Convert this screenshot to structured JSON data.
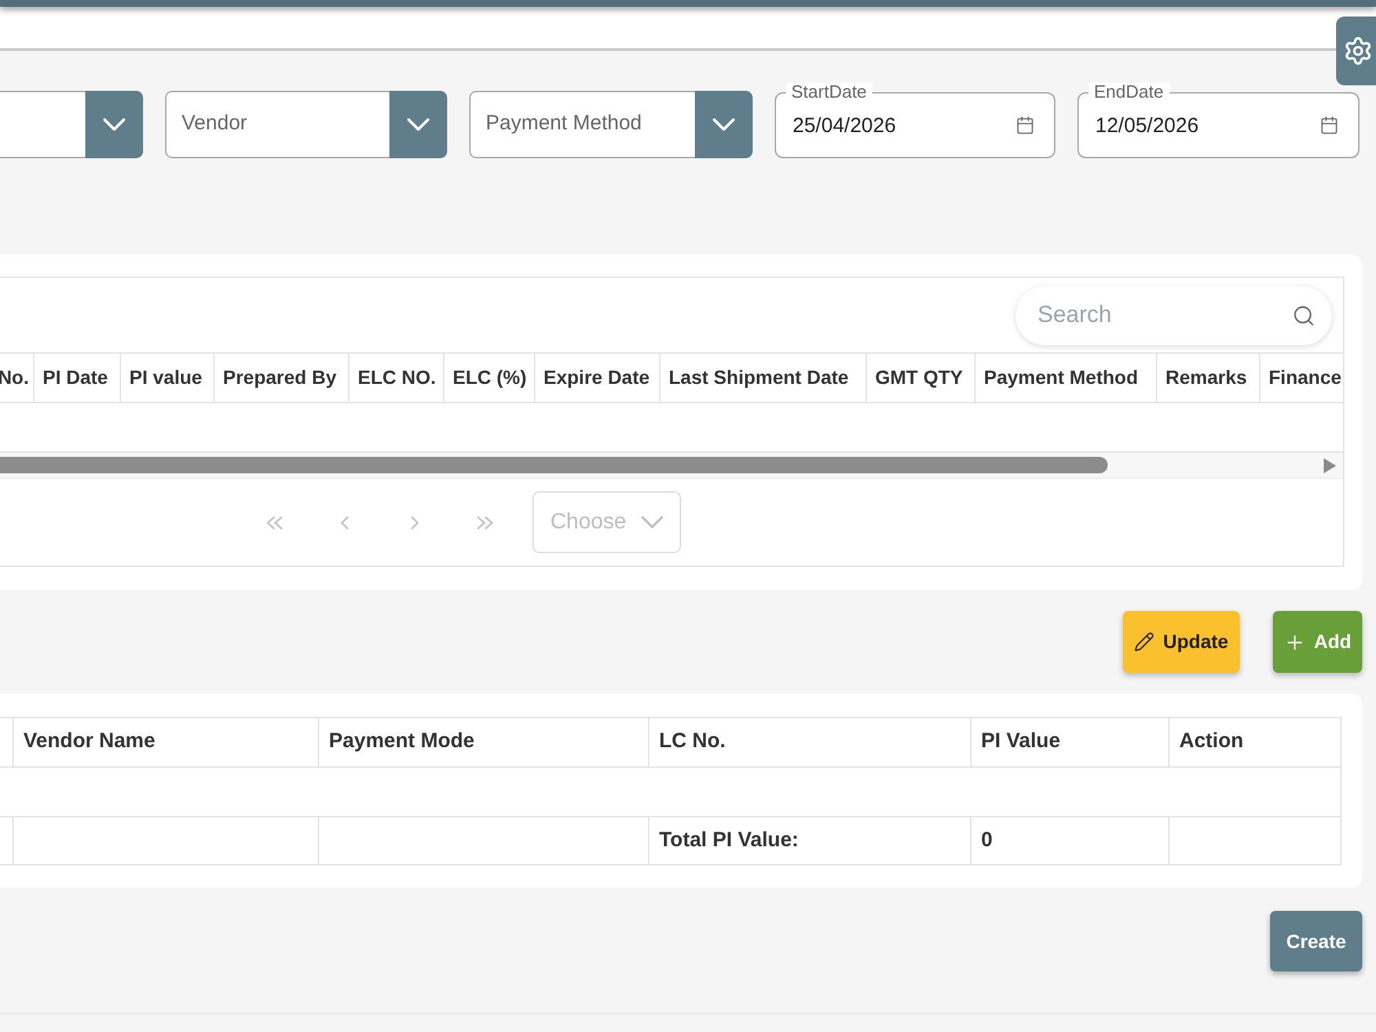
{
  "filters": [
    {
      "kind": "select"
    },
    {
      "kind": "select",
      "placeholder": "Vendor"
    },
    {
      "kind": "select",
      "placeholder": "Payment Method"
    },
    {
      "kind": "date",
      "label": "StartDate",
      "value": "25/04/2026"
    },
    {
      "kind": "date",
      "label": "EndDate",
      "value": "12/05/2026"
    }
  ],
  "pi_table": {
    "search": {
      "placeholder": "Search"
    },
    "columns": [
      "No.",
      "PI Date",
      "PI value",
      "Prepared By",
      "ELC NO.",
      "ELC (%)",
      "Expire Date",
      "Last Shipment Date",
      "GMT QTY",
      "Payment Method",
      "Remarks",
      "Finance"
    ],
    "pagination": {
      "buttons": [
        {
          "kind": "first",
          "disabled": true
        },
        {
          "kind": "previous",
          "disabled": true
        },
        {
          "kind": "next",
          "disabled": true
        },
        {
          "kind": "last",
          "disabled": true
        }
      ],
      "page_size": {
        "placeholder": "Choose"
      }
    }
  },
  "actions": [
    {
      "kind": "update",
      "label": "Update"
    },
    {
      "kind": "add",
      "label": "Add"
    }
  ],
  "details_table": {
    "columns": [
      "Vendor Name",
      "Payment Mode",
      "LC No.",
      "PI Value",
      "Action"
    ],
    "total": {
      "label": "Total PI Value:",
      "value": "0"
    }
  },
  "create_button": {
    "label": "Create"
  }
}
